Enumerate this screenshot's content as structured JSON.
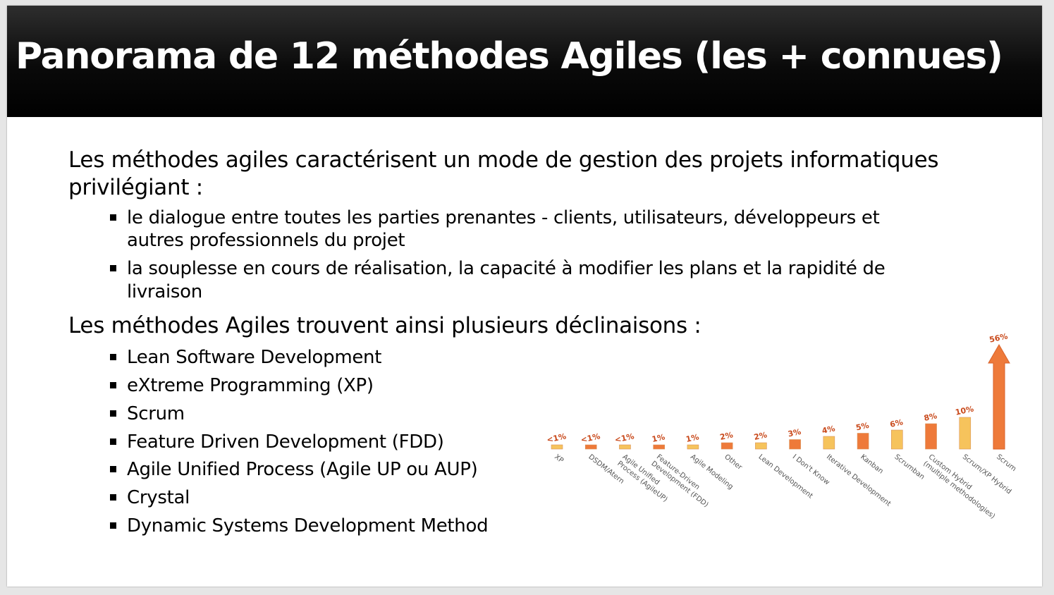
{
  "title": "Panorama de 12 méthodes Agiles (les + connues)",
  "intro": {
    "line1": "Les méthodes agiles caractérisent un mode de gestion des projets informatiques",
    "line2": "privilégiant :"
  },
  "priorities": [
    {
      "line1": "le dialogue entre toutes les parties prenantes - clients, utilisateurs, développeurs et",
      "line2": "autres professionnels du projet"
    },
    {
      "line1": "la souplesse en cours de réalisation, la capacité à modifier les plans et la rapidité de",
      "line2": "livraison"
    }
  ],
  "declinaisons_heading": "Les méthodes Agiles trouvent ainsi plusieurs déclinaisons :",
  "methods": [
    "Lean Software Development",
    "eXtreme Programming (XP)",
    "Scrum",
    "Feature Driven Development (FDD)",
    "Agile Unified Process (Agile UP ou AUP)",
    "Crystal",
    "Dynamic Systems Development Method"
  ],
  "colors": {
    "light": "#f6c35c",
    "dark": "#ee7a3a",
    "label": "#c94a1c"
  },
  "chart_data": {
    "type": "bar",
    "categories": [
      "XP",
      "DSDM/Atern",
      "Agile Unified Process (AgileUP)",
      "Feature-Driven Development (FDD)",
      "Agile Modeling",
      "Other",
      "Lean Development",
      "I Don't Know",
      "Iterative Development",
      "Kanban",
      "Scrumban",
      "Custom Hybrid (multiple methodologies)",
      "Scrum/XP Hybrid",
      "Scrum"
    ],
    "category_lines": [
      [
        "XP"
      ],
      [
        "DSDM/Atern"
      ],
      [
        "Agile Unified",
        "Process (AgileUP)"
      ],
      [
        "Feature-Driven",
        "Development (FDD)"
      ],
      [
        "Agile Modeling"
      ],
      [
        "Other"
      ],
      [
        "Lean Development"
      ],
      [
        "I Don't Know"
      ],
      [
        "Iterative Development"
      ],
      [
        "Kanban"
      ],
      [
        "Scrumban"
      ],
      [
        "Custom Hybrid",
        "(multiple methodologies)"
      ],
      [
        "Scrum/XP Hybrid"
      ],
      [
        "Scrum"
      ]
    ],
    "values": [
      0.5,
      0.5,
      0.5,
      1,
      1,
      2,
      2,
      3,
      4,
      5,
      6,
      8,
      10,
      56
    ],
    "value_labels": [
      "<1%",
      "<1%",
      "<1%",
      "1%",
      "1%",
      "2%",
      "2%",
      "3%",
      "4%",
      "5%",
      "6%",
      "8%",
      "10%",
      "56%"
    ],
    "color_keys": [
      "light",
      "dark",
      "light",
      "dark",
      "light",
      "dark",
      "light",
      "dark",
      "light",
      "dark",
      "light",
      "dark",
      "light",
      "dark"
    ],
    "unit": "%",
    "title": "",
    "xlabel": "",
    "ylabel": "",
    "grid": false,
    "legend": "none"
  }
}
